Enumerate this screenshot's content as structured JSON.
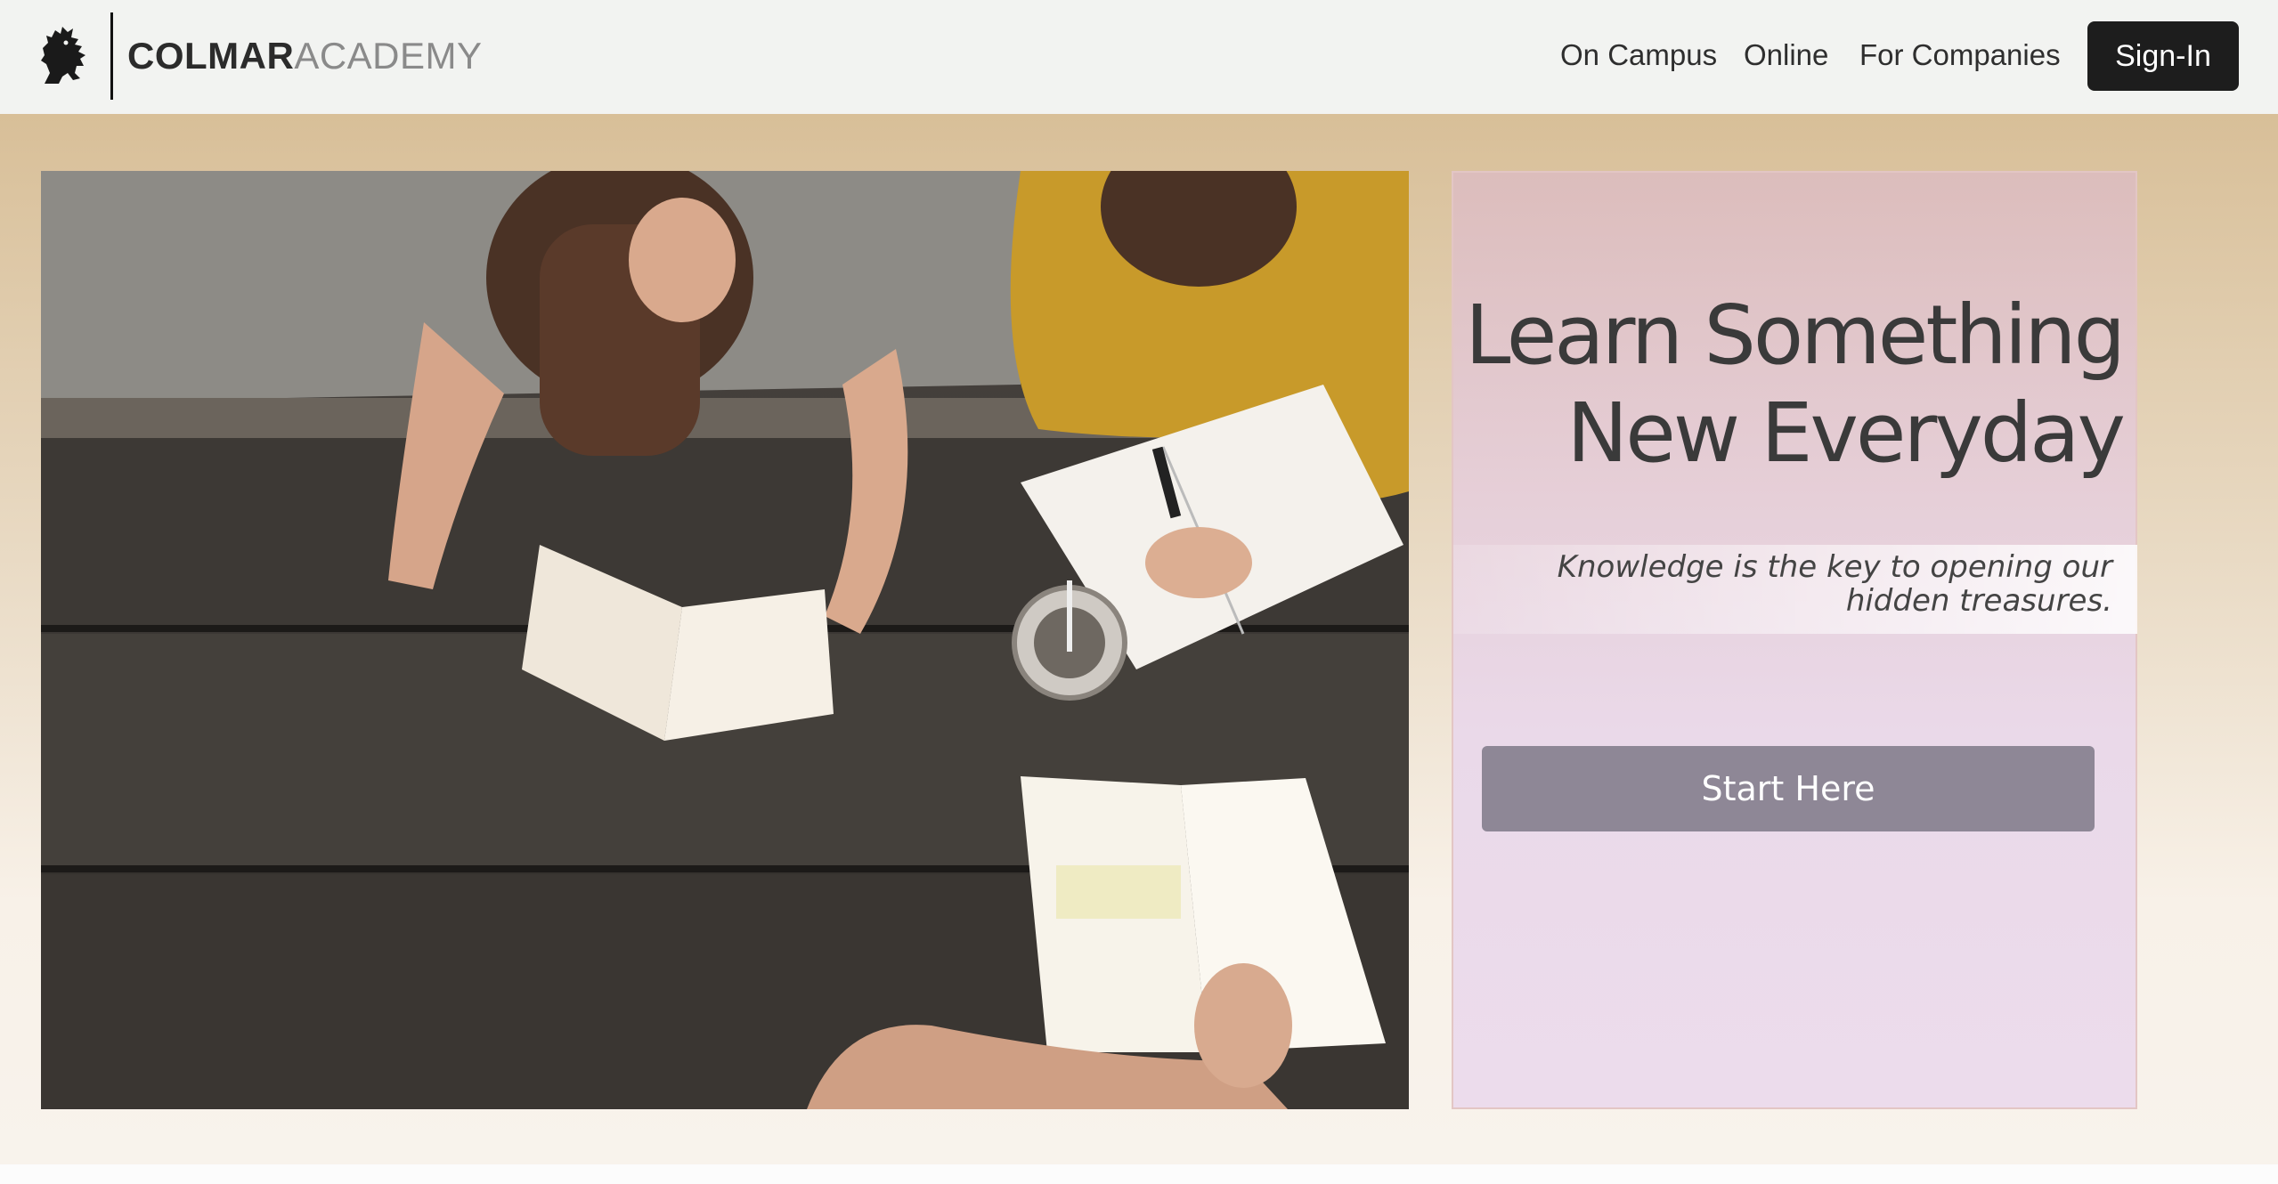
{
  "brand": {
    "name_strong": "COLMAR",
    "name_light": "ACADEMY",
    "logo_icon": "lion-rampant-icon"
  },
  "nav": {
    "items": [
      {
        "label": "On Campus"
      },
      {
        "label": "Online"
      },
      {
        "label": "For Companies"
      }
    ],
    "signin_label": "Sign-In"
  },
  "hero": {
    "photo_icon": "students-studying-photo",
    "headline_line1": "Learn Something",
    "headline_line2": "New Everyday",
    "tagline_line1": "Knowledge is the key to opening our",
    "tagline_line2": "hidden treasures.",
    "cta_label": "Start Here"
  },
  "colors": {
    "header_bg": "#f2f3f1",
    "signin_bg": "#1d1d1d",
    "hero_top": "#d8bf98",
    "card_top": "#dcbdbc",
    "card_bottom": "#ecdcec",
    "cta_bg": "#8e8796"
  }
}
